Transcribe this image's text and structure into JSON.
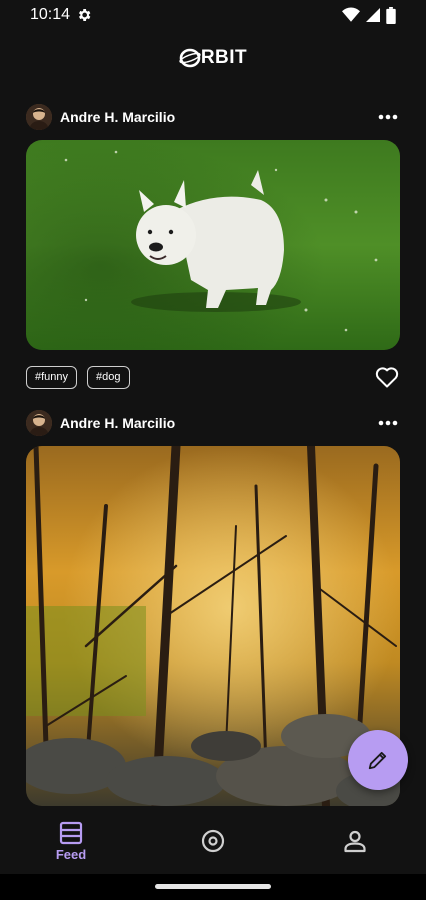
{
  "status_bar": {
    "time": "10:14"
  },
  "app": {
    "logo_text": "RBIT"
  },
  "posts": [
    {
      "author": "Andre H. Marcilio",
      "tags": [
        "#funny",
        "#dog"
      ]
    },
    {
      "author": "Andre H. Marcilio",
      "tags": []
    }
  ],
  "nav": {
    "items": [
      {
        "label": "Feed",
        "icon": "feed-icon",
        "active": true
      },
      {
        "label": "",
        "icon": "explore-icon",
        "active": false
      },
      {
        "label": "",
        "icon": "profile-icon",
        "active": false
      }
    ]
  },
  "colors": {
    "background": "#121212",
    "accent": "#b79cf2",
    "fab": "#b79cf2"
  }
}
